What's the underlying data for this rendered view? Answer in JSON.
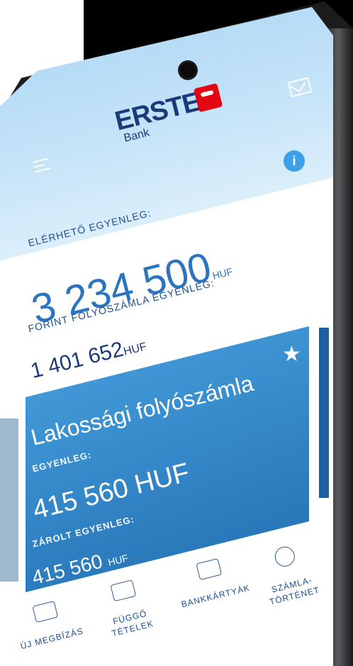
{
  "brand": {
    "name": "ERSTE",
    "sub": "Bank"
  },
  "header": {
    "menu_icon": "hamburger-icon",
    "info_icon": "info-icon",
    "mail_icon": "mail-icon",
    "info_glyph": "i"
  },
  "balances": {
    "available_label": "ELÉRHETŐ EGYENLEG:",
    "available_amount": "3 234 500",
    "available_currency": "HUF",
    "forint_label": "FORINT FOLYÓSZÁMLA EGYENLEG:",
    "forint_amount": "1 401 652",
    "forint_currency": "HUF"
  },
  "card": {
    "title": "Lakossági folyószámla",
    "balance_label": "EGYENLEG:",
    "balance_amount": "415 560 HUF",
    "locked_label": "ZÁROLT EGYENLEG:",
    "locked_amount": "415 560",
    "locked_currency": "HUF",
    "star_glyph": "★"
  },
  "actions": [
    {
      "label_1": "ÚJ MEGBÍZÁS",
      "label_2": "",
      "icon": "transfer-icon"
    },
    {
      "label_1": "FÜGGŐ",
      "label_2": "TÉTELEK",
      "icon": "pending-icon"
    },
    {
      "label_1": "BANKKÁRTYÁK",
      "label_2": "",
      "icon": "card-icon"
    },
    {
      "label_1": "SZÁMLA-",
      "label_2": "TÖRTÉNET",
      "icon": "history-icon"
    }
  ],
  "colors": {
    "accent": "#2a74c0",
    "brand": "#1b3a78",
    "logo_red": "#e30613"
  }
}
